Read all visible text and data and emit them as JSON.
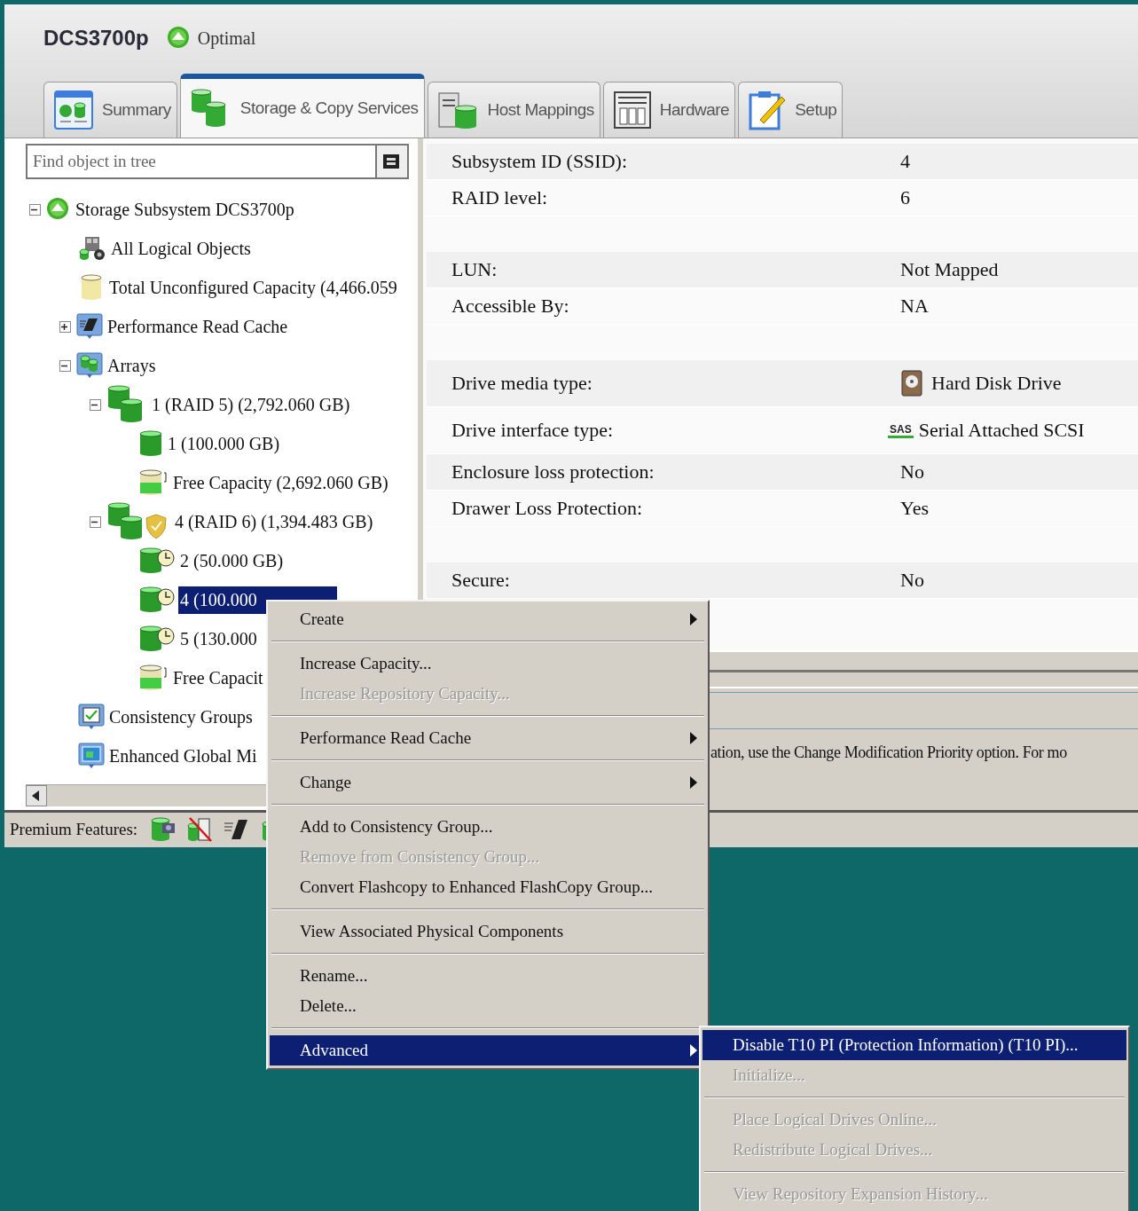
{
  "header": {
    "title": "DCS3700p",
    "status": "Optimal"
  },
  "tabs": [
    {
      "label": "Summary",
      "kind": "summary",
      "selected": false
    },
    {
      "label": "Storage & Copy Services",
      "kind": "storage",
      "selected": true
    },
    {
      "label": "Host Mappings",
      "kind": "hosts",
      "selected": false
    },
    {
      "label": "Hardware",
      "kind": "hardware",
      "selected": false
    },
    {
      "label": "Setup",
      "kind": "setup",
      "selected": false
    }
  ],
  "search": {
    "placeholder": "Find object in tree"
  },
  "tree": [
    {
      "label": "Storage Subsystem DCS3700p",
      "kind": "subsystem",
      "expanded": true,
      "selected": false,
      "children": [
        {
          "label": "All Logical Objects",
          "kind": "objects",
          "selected": false
        },
        {
          "label": "Total Unconfigured Capacity (4,466.059",
          "kind": "unconfigured",
          "selected": false
        },
        {
          "label": "Performance Read Cache",
          "kind": "cache",
          "expanded": false,
          "selected": false
        },
        {
          "label": "Arrays",
          "kind": "arrays",
          "expanded": true,
          "selected": false,
          "children": [
            {
              "label": "1 (RAID 5) (2,792.060 GB)",
              "kind": "array",
              "secured": false,
              "expanded": true,
              "selected": false,
              "children": [
                {
                  "label": "1 (100.000 GB)",
                  "kind": "drive",
                  "selected": false
                },
                {
                  "label": "Free Capacity (2,692.060 GB)",
                  "kind": "free",
                  "selected": false
                }
              ]
            },
            {
              "label": "4 (RAID 6) (1,394.483 GB)",
              "kind": "array",
              "secured": true,
              "expanded": true,
              "selected": false,
              "children": [
                {
                  "label": "2 (50.000 GB)",
                  "kind": "scheduled",
                  "selected": false
                },
                {
                  "label": "4 (100.000",
                  "kind": "scheduled",
                  "selected": true
                },
                {
                  "label": "5 (130.000",
                  "kind": "scheduled",
                  "selected": false
                },
                {
                  "label": "Free Capacit",
                  "kind": "free",
                  "selected": false
                }
              ]
            }
          ]
        },
        {
          "label": "Consistency Groups",
          "kind": "groups",
          "selected": false
        },
        {
          "label": "Enhanced Global Mi",
          "kind": "mirror",
          "selected": false
        }
      ]
    }
  ],
  "properties": [
    [
      {
        "label": "Subsystem ID (SSID):",
        "value": "4"
      },
      {
        "label": "RAID level:",
        "value": "6"
      }
    ],
    [
      {
        "label": "LUN:",
        "value": "Not Mapped"
      },
      {
        "label": "Accessible By:",
        "value": "NA"
      }
    ],
    [
      {
        "label": "Drive media type:",
        "value": "Hard Disk Drive",
        "kind": "disk"
      },
      {
        "label": "Drive interface type:",
        "value": "Serial Attached SCSI",
        "kind": "sas",
        "badge": "SAS"
      },
      {
        "label": "Enclosure loss protection:",
        "value": "No"
      },
      {
        "label": "Drawer Loss Protection:",
        "value": "Yes"
      }
    ],
    [
      {
        "label": "Secure:",
        "value": "No"
      }
    ]
  ],
  "description": "ation, use the Change Modification Priority option. For mo",
  "premium": {
    "label": "Premium Features:",
    "features": [
      {
        "kind": "snapshot",
        "disabled": false
      },
      {
        "kind": "copy",
        "disabled": true
      },
      {
        "kind": "cache",
        "disabled": false
      },
      {
        "kind": "drive",
        "disabled": false
      }
    ]
  },
  "menu": [
    [
      {
        "label": "Create",
        "disabled": false,
        "submenu": true,
        "selected": false
      }
    ],
    [
      {
        "label": "Increase Capacity...",
        "disabled": false,
        "submenu": false,
        "selected": false
      },
      {
        "label": "Increase Repository Capacity...",
        "disabled": true,
        "submenu": false,
        "selected": false
      }
    ],
    [
      {
        "label": "Performance Read Cache",
        "disabled": false,
        "submenu": true,
        "selected": false
      }
    ],
    [
      {
        "label": "Change",
        "disabled": false,
        "submenu": true,
        "selected": false
      }
    ],
    [
      {
        "label": "Add to Consistency Group...",
        "disabled": false,
        "submenu": false,
        "selected": false
      },
      {
        "label": "Remove from Consistency Group...",
        "disabled": true,
        "submenu": false,
        "selected": false
      },
      {
        "label": "Convert Flashcopy to Enhanced FlashCopy Group...",
        "disabled": false,
        "submenu": false,
        "selected": false
      }
    ],
    [
      {
        "label": "View Associated Physical Components",
        "disabled": false,
        "submenu": false,
        "selected": false
      }
    ],
    [
      {
        "label": "Rename...",
        "disabled": false,
        "submenu": false,
        "selected": false
      },
      {
        "label": "Delete...",
        "disabled": false,
        "submenu": false,
        "selected": false
      }
    ],
    [
      {
        "label": "Advanced",
        "disabled": false,
        "submenu": true,
        "selected": true
      }
    ]
  ],
  "submenu": [
    [
      {
        "label": "Disable T10 PI (Protection Information) (T10 PI)...",
        "disabled": false,
        "selected": true
      },
      {
        "label": "Initialize...",
        "disabled": true,
        "selected": false
      }
    ],
    [
      {
        "label": "Place Logical Drives Online...",
        "disabled": true,
        "selected": false
      },
      {
        "label": "Redistribute Logical Drives...",
        "disabled": true,
        "selected": false
      }
    ],
    [
      {
        "label": "View Repository Expansion History...",
        "disabled": true,
        "selected": false
      }
    ]
  ]
}
